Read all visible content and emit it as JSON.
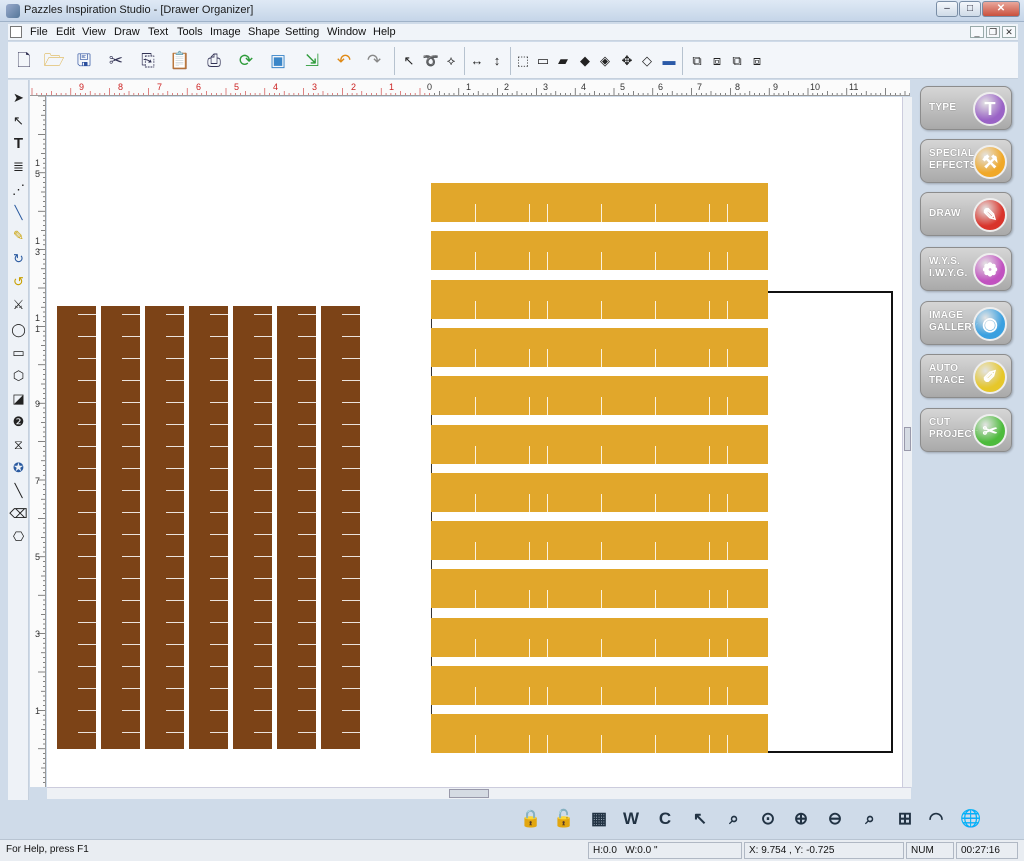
{
  "window": {
    "title": "Pazzles Inspiration Studio - [Drawer Organizer]",
    "controls": {
      "minimize": "–",
      "maximize": "□",
      "close": "✕"
    }
  },
  "menu": {
    "items": [
      "File",
      "Edit",
      "View",
      "Draw",
      "Text",
      "Tools",
      "Image",
      "Shape",
      "Setting",
      "Window",
      "Help"
    ],
    "mdi": {
      "minimize": "_",
      "restore": "❐",
      "close": "✕"
    }
  },
  "toolbar": {
    "icons": [
      "new-icon",
      "open-icon",
      "save-icon",
      "cut-icon",
      "copy-icon",
      "paste-icon",
      "print-icon",
      "refresh-icon",
      "gallery-icon",
      "import-icon",
      "undo-icon",
      "redo-icon"
    ],
    "shape_tools": [
      "select-arrow-icon",
      "lasso-icon",
      "node-icon",
      "flip-horizontal-icon",
      "flip-vertical-icon",
      "shape-tool-1-icon",
      "shape-tool-2-icon",
      "shape-tool-3-icon",
      "shape-tool-4-icon",
      "shape-tool-5-icon",
      "move-icon",
      "shape-tool-6-icon",
      "shape-tool-7-icon",
      "group-icon",
      "ungroup-icon",
      "combine-icon",
      "break-apart-icon"
    ]
  },
  "left_tools": [
    "pointer-icon",
    "node-edit-icon",
    "text-icon",
    "text-path-icon",
    "dotted-line-icon",
    "line-icon",
    "pencil-icon",
    "curve-icon",
    "spiral-icon",
    "knife-icon",
    "ellipse-icon",
    "rectangle-icon",
    "polygon-icon",
    "shape-library-icon",
    "shadow-icon",
    "blend-icon",
    "star-icon",
    "pen-icon",
    "eraser-icon",
    "stamp-icon"
  ],
  "ruler": {
    "top_labels": [
      "9",
      "8",
      "7",
      "6",
      "5",
      "4",
      "3",
      "2",
      "1",
      "0",
      "1",
      "2",
      "3",
      "4",
      "5",
      "6",
      "7",
      "8",
      "9",
      "10",
      "11"
    ],
    "left_labels": [
      "1\n5",
      "1\n3",
      "1\n1",
      "9",
      "7",
      "5",
      "3",
      "1"
    ]
  },
  "canvas": {
    "brown_color": "#7c4317",
    "gold_color": "#e1a72b",
    "brown_strip_count": 7,
    "gold_strip_count": 12
  },
  "right_panel": {
    "buttons": [
      {
        "label": "TYPE",
        "icon": "type-icon",
        "glyph": "T",
        "color": "#9a63c6"
      },
      {
        "label": "SPECIAL\nEFFECTS",
        "icon": "hammer-icon",
        "glyph": "⚒",
        "color": "#f0a828"
      },
      {
        "label": "DRAW",
        "icon": "draw-pencil-icon",
        "glyph": "✎",
        "color": "#d9342b"
      },
      {
        "label": "W.Y.S.\nI.W.Y.G.",
        "icon": "wysiwyg-icon",
        "glyph": "❁",
        "color": "#c152c0"
      },
      {
        "label": "IMAGE\nGALLERY",
        "icon": "eye-icon",
        "glyph": "◉",
        "color": "#3aa0e0"
      },
      {
        "label": "AUTO\nTRACE",
        "icon": "auto-trace-icon",
        "glyph": "✐",
        "color": "#e6c72a"
      },
      {
        "label": "CUT\nPROJECT",
        "icon": "cut-project-icon",
        "glyph": "✂",
        "color": "#4dbb3c"
      }
    ]
  },
  "zoom_bar": {
    "buttons": [
      {
        "name": "lock-icon",
        "glyph": "🔒"
      },
      {
        "name": "unlock-icon",
        "glyph": "🔓"
      },
      {
        "name": "grid-icon",
        "glyph": "▦"
      },
      {
        "name": "weld-icon",
        "glyph": "W"
      },
      {
        "name": "contour-icon",
        "glyph": "C"
      },
      {
        "name": "zoom-back-icon",
        "glyph": "↖"
      },
      {
        "name": "zoom-selection-icon",
        "glyph": "⌕"
      },
      {
        "name": "zoom-all-icon",
        "glyph": "⊙"
      },
      {
        "name": "zoom-in-icon",
        "glyph": "⊕"
      },
      {
        "name": "zoom-out-icon",
        "glyph": "⊖"
      },
      {
        "name": "zoom-actual-icon",
        "glyph": "⌕"
      },
      {
        "name": "web-icon",
        "glyph": "⊞"
      },
      {
        "name": "cutter-icon",
        "glyph": "◠"
      },
      {
        "name": "globe-icon",
        "glyph": "🌐"
      }
    ]
  },
  "status": {
    "help": "For Help, press F1",
    "size": "H:0.0   W:0.0 \"",
    "coords": "X: 9.754 , Y: -0.725",
    "num": "NUM",
    "time": "00:27:16"
  }
}
